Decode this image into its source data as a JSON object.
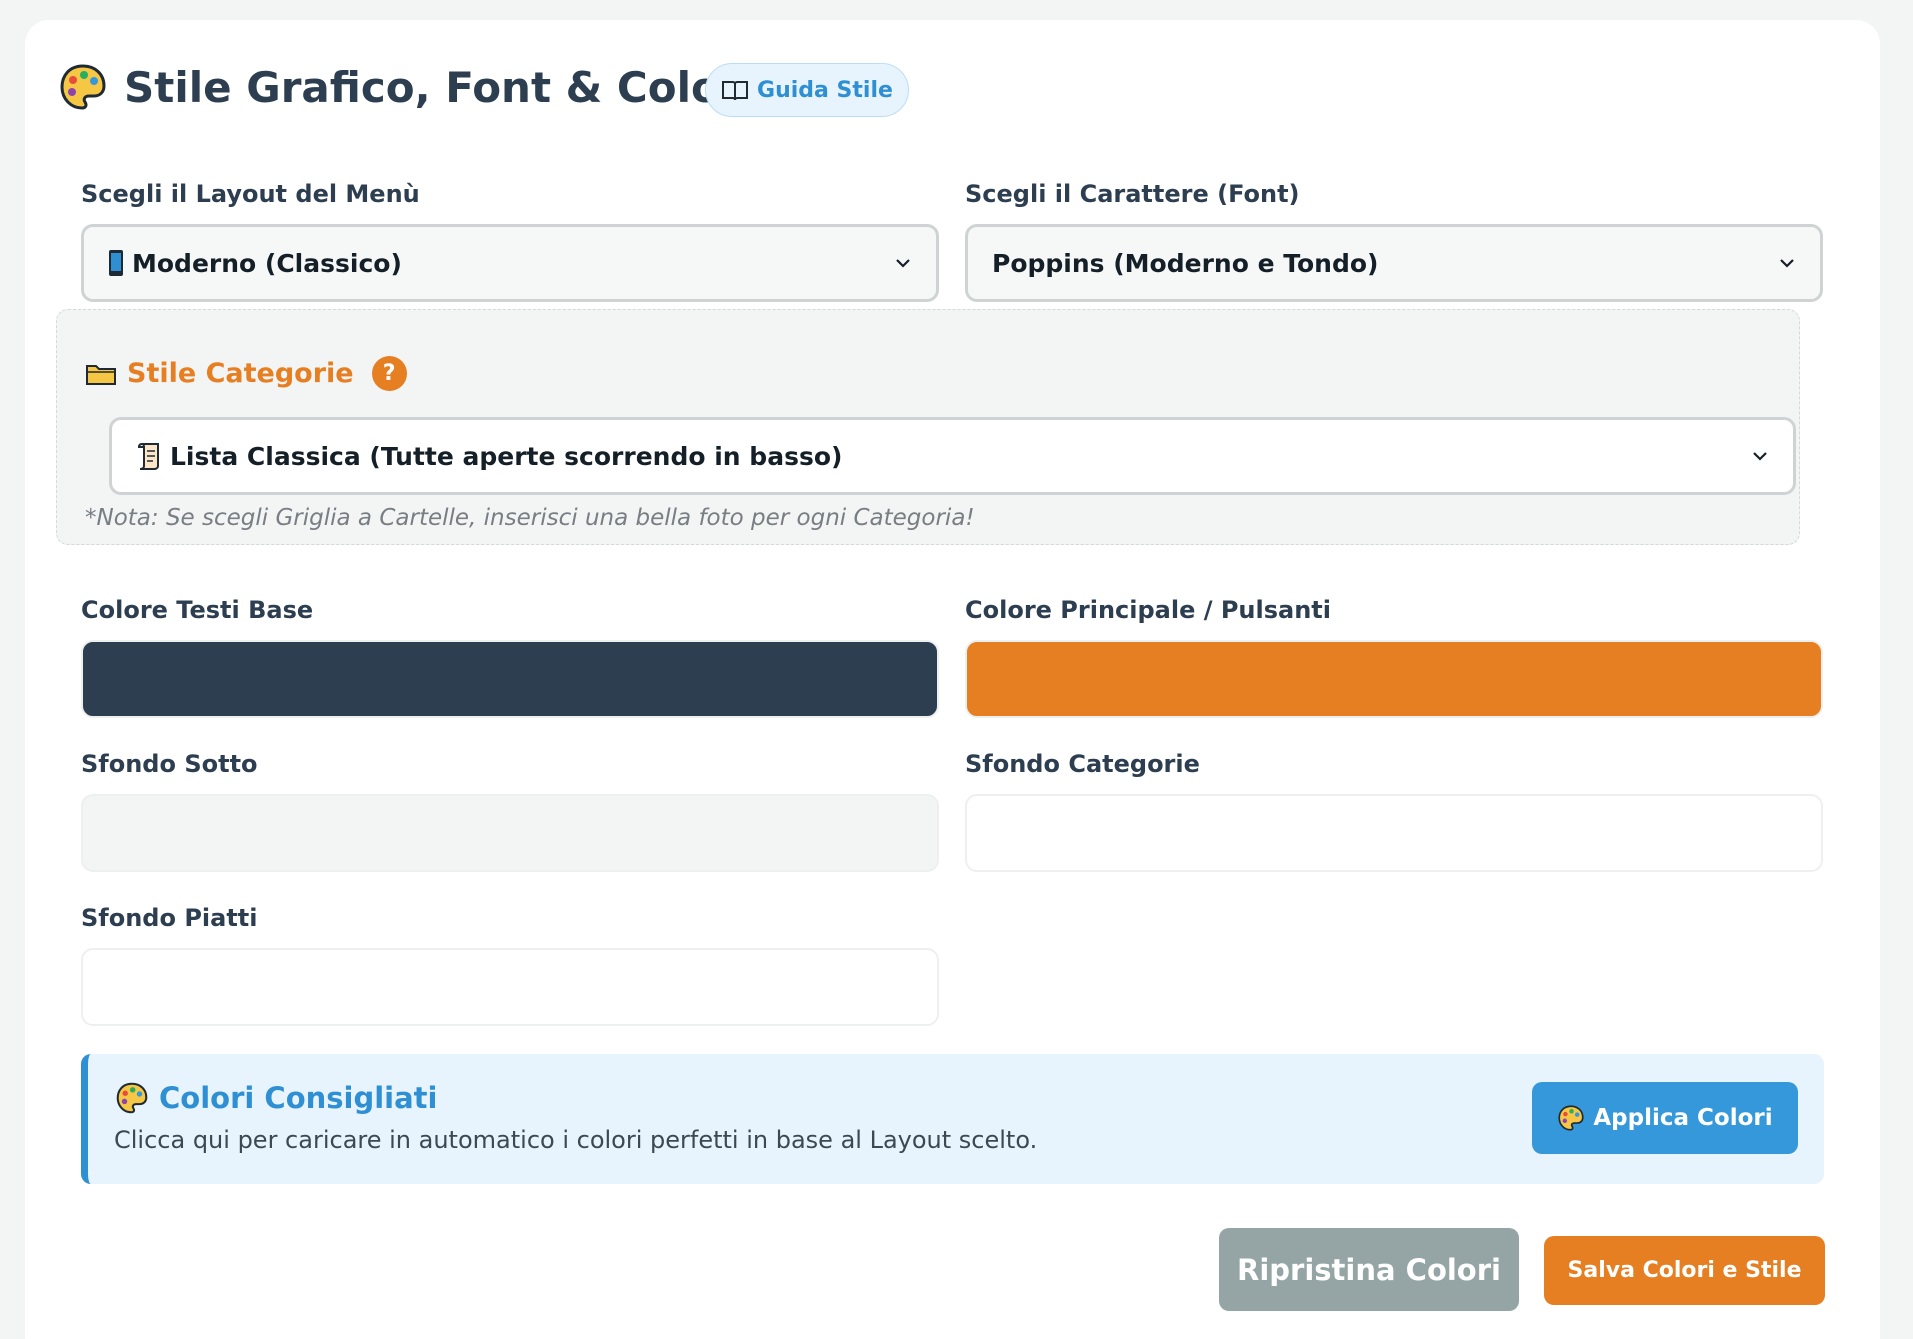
{
  "header": {
    "title": "Stile Grafico, Font & Colori",
    "guide_label": "Guida Stile"
  },
  "layout_field": {
    "label": "Scegli il Layout del Menù",
    "value": "Moderno (Classico)"
  },
  "font_field": {
    "label": "Scegli il Carattere (Font)",
    "value": "Poppins (Moderno e Tondo)"
  },
  "category_style": {
    "title": "Stile Categorie",
    "help": "?",
    "value": "Lista Classica (Tutte aperte scorrendo in basso)",
    "note": "*Nota: Se scegli Griglia a Cartelle, inserisci una bella foto per ogni Categoria!"
  },
  "colors": {
    "text_base": {
      "label": "Colore Testi Base",
      "color": "#2c3e50"
    },
    "primary": {
      "label": "Colore Principale / Pulsanti",
      "color": "#e67e22"
    },
    "bg_bottom": {
      "label": "Sfondo Sotto",
      "color": "#f3f4f4"
    },
    "bg_categories": {
      "label": "Sfondo Categorie",
      "color": "#ffffff"
    },
    "bg_dishes": {
      "label": "Sfondo Piatti",
      "color": "#ffffff"
    }
  },
  "suggested": {
    "title": "Colori Consigliati",
    "description": "Clicca qui per caricare in automatico i colori perfetti in base al Layout scelto.",
    "apply_label": "Applica Colori"
  },
  "actions": {
    "reset_label": "Ripristina Colori",
    "save_label": "Salva Colori e Stile"
  },
  "icons": {
    "title": "palette-icon",
    "guide": "book-icon",
    "layout": "mobile-phone-icon",
    "category": "folder-icon",
    "category_select": "scroll-icon",
    "dropdown": "chevron-down-icon"
  }
}
